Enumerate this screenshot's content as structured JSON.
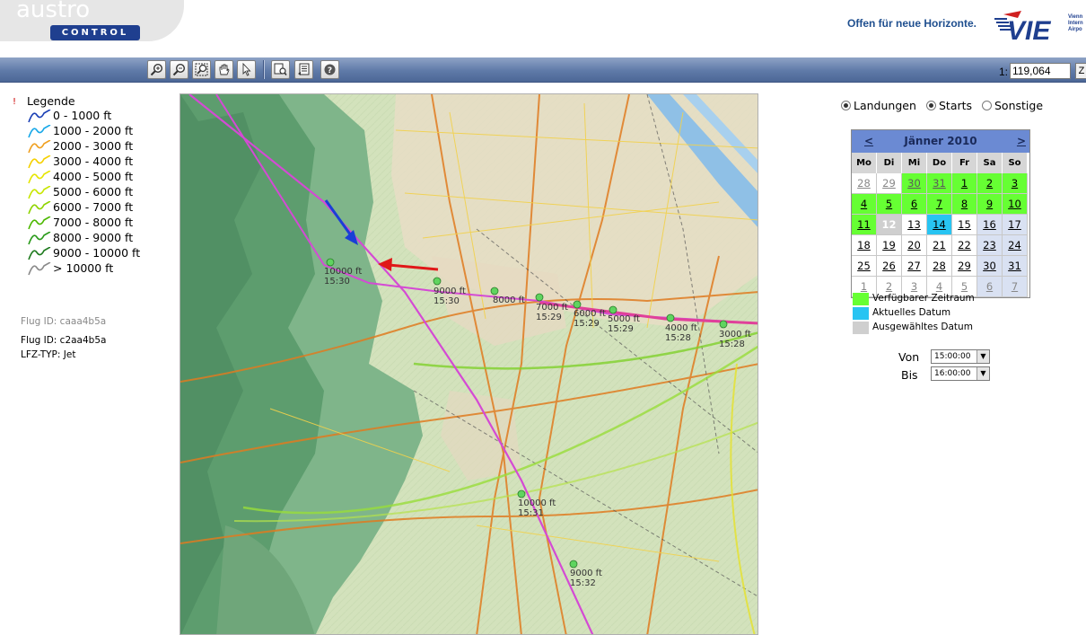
{
  "header": {
    "logo_top": "austro",
    "logo_bottom": "CONTROL",
    "slogan": "Offen für neue Horizonte.",
    "airport_logo": "VIE",
    "airport_small": [
      "Vienn",
      "Intern",
      "Airpo"
    ]
  },
  "toolbar": {
    "tools": [
      "zoom-in-icon",
      "zoom-out-icon",
      "zoom-extent-icon",
      "pan-hand-icon",
      "select-arrow-icon",
      "identify-icon",
      "list-icon",
      "help-icon"
    ],
    "scale_prefix": "1:",
    "scale_value": "119,064",
    "scale_button": "Z"
  },
  "legend": {
    "title": "Legende",
    "items": [
      {
        "label": "0 - 1000 ft",
        "color": "#1a3fb5"
      },
      {
        "label": "1000 - 2000 ft",
        "color": "#18a8e8"
      },
      {
        "label": "2000 - 3000 ft",
        "color": "#f0a020"
      },
      {
        "label": "3000 - 4000 ft",
        "color": "#f5d000"
      },
      {
        "label": "4000 - 5000 ft",
        "color": "#e6e600"
      },
      {
        "label": "5000 - 6000 ft",
        "color": "#c8e600"
      },
      {
        "label": "6000 - 7000 ft",
        "color": "#8fd400"
      },
      {
        "label": "7000 - 8000 ft",
        "color": "#4cb800"
      },
      {
        "label": "8000 - 9000 ft",
        "color": "#2a9a1a"
      },
      {
        "label": "9000 - 10000 ft",
        "color": "#1e7a1e"
      },
      {
        "label": "> 10000 ft",
        "color": "#8a8a8a"
      }
    ]
  },
  "flights": {
    "flug_id_1": "Flug ID: caaa4b5a",
    "flug_id_2": "Flug ID: c2aa4b5a",
    "lfz_typ": "LFZ-TYP: Jet"
  },
  "map": {
    "track_points": [
      {
        "alt": "10000 ft",
        "time": "15:30"
      },
      {
        "alt": "9000 ft",
        "time": "15:30"
      },
      {
        "alt": "8000 ft",
        "time": ""
      },
      {
        "alt": "7000 ft",
        "time": "15:29"
      },
      {
        "alt": "6000 ft",
        "time": "15:29"
      },
      {
        "alt": "5000 ft",
        "time": "15:29"
      },
      {
        "alt": "4000 ft",
        "time": "15:28"
      },
      {
        "alt": "3000 ft",
        "time": "15:28"
      },
      {
        "alt": "10000 ft",
        "time": "15:31"
      },
      {
        "alt": "9000 ft",
        "time": "15:32"
      }
    ]
  },
  "filter": {
    "options": [
      {
        "label": "Landungen",
        "checked": true
      },
      {
        "label": "Starts",
        "checked": true
      },
      {
        "label": "Sonstige",
        "checked": false
      }
    ]
  },
  "calendar": {
    "prev": "<",
    "next": ">",
    "title": "Jänner 2010",
    "weekdays": [
      "Mo",
      "Di",
      "Mi",
      "Do",
      "Fr",
      "Sa",
      "So"
    ],
    "weeks": [
      [
        {
          "d": "28",
          "s": "other"
        },
        {
          "d": "29",
          "s": "other"
        },
        {
          "d": "30",
          "s": "other green"
        },
        {
          "d": "31",
          "s": "other green"
        },
        {
          "d": "1",
          "s": "green"
        },
        {
          "d": "2",
          "s": "green"
        },
        {
          "d": "3",
          "s": "green"
        }
      ],
      [
        {
          "d": "4",
          "s": "green"
        },
        {
          "d": "5",
          "s": "green"
        },
        {
          "d": "6",
          "s": "green"
        },
        {
          "d": "7",
          "s": "green"
        },
        {
          "d": "8",
          "s": "green"
        },
        {
          "d": "9",
          "s": "green"
        },
        {
          "d": "10",
          "s": "green"
        }
      ],
      [
        {
          "d": "11",
          "s": "green"
        },
        {
          "d": "12",
          "s": "sel"
        },
        {
          "d": "13",
          "s": ""
        },
        {
          "d": "14",
          "s": "cur"
        },
        {
          "d": "15",
          "s": ""
        },
        {
          "d": "16",
          "s": "weekend"
        },
        {
          "d": "17",
          "s": "weekend"
        }
      ],
      [
        {
          "d": "18",
          "s": ""
        },
        {
          "d": "19",
          "s": ""
        },
        {
          "d": "20",
          "s": ""
        },
        {
          "d": "21",
          "s": ""
        },
        {
          "d": "22",
          "s": ""
        },
        {
          "d": "23",
          "s": "weekend"
        },
        {
          "d": "24",
          "s": "weekend"
        }
      ],
      [
        {
          "d": "25",
          "s": ""
        },
        {
          "d": "26",
          "s": ""
        },
        {
          "d": "27",
          "s": ""
        },
        {
          "d": "28",
          "s": ""
        },
        {
          "d": "29",
          "s": ""
        },
        {
          "d": "30",
          "s": "weekend"
        },
        {
          "d": "31",
          "s": "weekend"
        }
      ],
      [
        {
          "d": "1",
          "s": "other"
        },
        {
          "d": "2",
          "s": "other"
        },
        {
          "d": "3",
          "s": "other"
        },
        {
          "d": "4",
          "s": "other"
        },
        {
          "d": "5",
          "s": "other"
        },
        {
          "d": "6",
          "s": "other weekend"
        },
        {
          "d": "7",
          "s": "other weekend"
        }
      ]
    ]
  },
  "key": {
    "available": {
      "label": "Verfügbarer Zeitraum",
      "color": "#66ff33"
    },
    "current": {
      "label": "Aktuelles Datum",
      "color": "#28c4f2"
    },
    "selected": {
      "label": "Ausgewähltes Datum",
      "color": "#cfcfcf"
    }
  },
  "time": {
    "von_label": "Von",
    "von_value": "15:00:00",
    "bis_label": "Bis",
    "bis_value": "16:00:00"
  }
}
